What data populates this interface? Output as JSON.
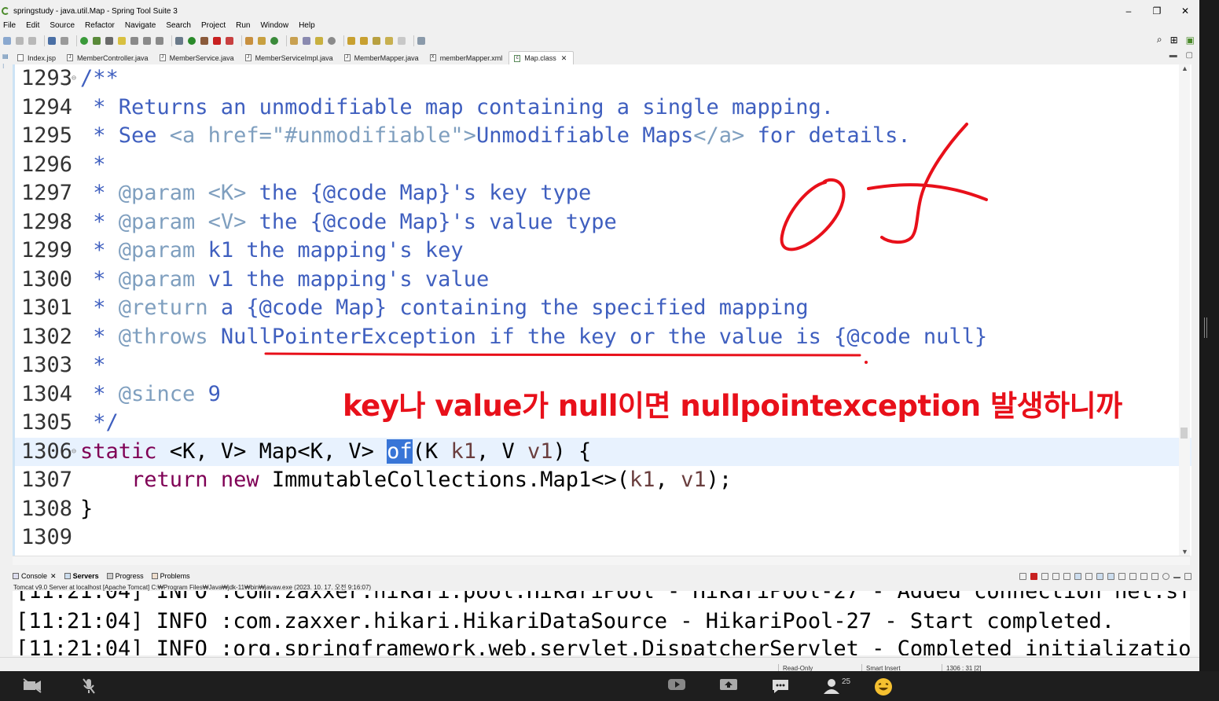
{
  "window": {
    "title": "springstudy - java.util.Map - Spring Tool Suite 3",
    "controls": [
      "–",
      "❐",
      "✕"
    ]
  },
  "menu": [
    "File",
    "Edit",
    "Source",
    "Refactor",
    "Navigate",
    "Search",
    "Project",
    "Run",
    "Window",
    "Help"
  ],
  "tabs": [
    {
      "label": "Index.jsp",
      "icon": "jsp-file-icon",
      "active": false
    },
    {
      "label": "MemberController.java",
      "icon": "java-file-icon",
      "active": false
    },
    {
      "label": "MemberService.java",
      "icon": "java-file-icon",
      "active": false
    },
    {
      "label": "MemberServiceImpl.java",
      "icon": "java-file-icon",
      "active": false
    },
    {
      "label": "MemberMapper.java",
      "icon": "java-file-icon",
      "active": false
    },
    {
      "label": "memberMapper.xml",
      "icon": "xml-file-icon",
      "active": false
    },
    {
      "label": "Map.class",
      "icon": "class-file-icon",
      "active": true
    }
  ],
  "editor": {
    "lines": [
      {
        "num": "1293",
        "fold": true
      },
      {
        "num": "1294"
      },
      {
        "num": "1295"
      },
      {
        "num": "1296"
      },
      {
        "num": "1297"
      },
      {
        "num": "1298"
      },
      {
        "num": "1299"
      },
      {
        "num": "1300"
      },
      {
        "num": "1301"
      },
      {
        "num": "1302"
      },
      {
        "num": "1303"
      },
      {
        "num": "1304"
      },
      {
        "num": "1305"
      },
      {
        "num": "1306",
        "fold": true,
        "current": true
      },
      {
        "num": "1307"
      },
      {
        "num": "1308"
      },
      {
        "num": "1309"
      }
    ],
    "code": {
      "l1293": "/**",
      "l1294": " * Returns an unmodifiable map containing a single mapping.",
      "l1295a": " * See ",
      "l1295b": "<a href=\"#unmodifiable\">",
      "l1295c": "Unmodifiable Maps",
      "l1295d": "</a>",
      "l1295e": " for details.",
      "l1296": " *",
      "l1297a": " * ",
      "l1297b": "@param",
      "l1297c": " ",
      "l1297d": "<K>",
      "l1297e": " the {@code Map}'s key type",
      "l1298a": " * ",
      "l1298b": "@param",
      "l1298c": " ",
      "l1298d": "<V>",
      "l1298e": " the {@code Map}'s value type",
      "l1299a": " * ",
      "l1299b": "@param",
      "l1299c": " k1 the mapping's key",
      "l1300a": " * ",
      "l1300b": "@param",
      "l1300c": " v1 the mapping's value",
      "l1301a": " * ",
      "l1301b": "@return",
      "l1301c": " a {@code Map} containing the specified mapping",
      "l1302a": " * ",
      "l1302b": "@throws",
      "l1302c": " NullPointerException if the key or the value is {@code null}",
      "l1303": " *",
      "l1304a": " * ",
      "l1304b": "@since",
      "l1304c": " 9",
      "l1305": " */",
      "l1306a": "static",
      "l1306b": " <K, V> Map<K, V> ",
      "l1306c": "of",
      "l1306d": "(K ",
      "l1306e": "k1",
      "l1306f": ", V ",
      "l1306g": "v1",
      "l1306h": ") {",
      "l1307a": "    ",
      "l1307b": "return",
      "l1307c": " ",
      "l1307d": "new",
      "l1307e": " ImmutableCollections.Map1<>(",
      "l1307f": "k1",
      "l1307g": ", ",
      "l1307h": "v1",
      "l1307i": ");",
      "l1308": "}",
      "l1309": ""
    }
  },
  "annotation": {
    "text": "key나 value가 null이면 nullpointexception 발생하니까",
    "color": "#e8101a"
  },
  "bottom_panel": {
    "tabs": [
      {
        "label": "Console",
        "active": false,
        "closable": true
      },
      {
        "label": "Servers",
        "active": true
      },
      {
        "label": "Progress",
        "active": false
      },
      {
        "label": "Problems",
        "active": false
      }
    ],
    "server_line": "Tomcat v9.0 Server at localhost [Apache Tomcat] C:₩Program Files₩Java₩jdk-11₩bin₩javaw.exe  (2023. 10. 17. 오전 9:16:07)",
    "console_lines": [
      "[11:21:04] INFO :com.zaxxer.hikari.pool.HikariPool - HikariPool-27 - Added connection net.sf.l",
      "[11:21:04] INFO :com.zaxxer.hikari.HikariDataSource - HikariPool-27 - Start completed.",
      "[11:21:04] INFO :org.springframework.web.servlet.DispatcherServlet - Completed initialization"
    ]
  },
  "status": {
    "mode": "Read-Only",
    "insert": "Smart Insert",
    "position": "1306 : 31 [2]"
  },
  "meeting": {
    "participants": "25"
  },
  "colors": {
    "comment": "#3f5fbf",
    "javadoc_tag": "#7f9fbf",
    "keyword": "#7f0055",
    "selection": "#3875d7",
    "current_line": "#e8f2fe"
  }
}
